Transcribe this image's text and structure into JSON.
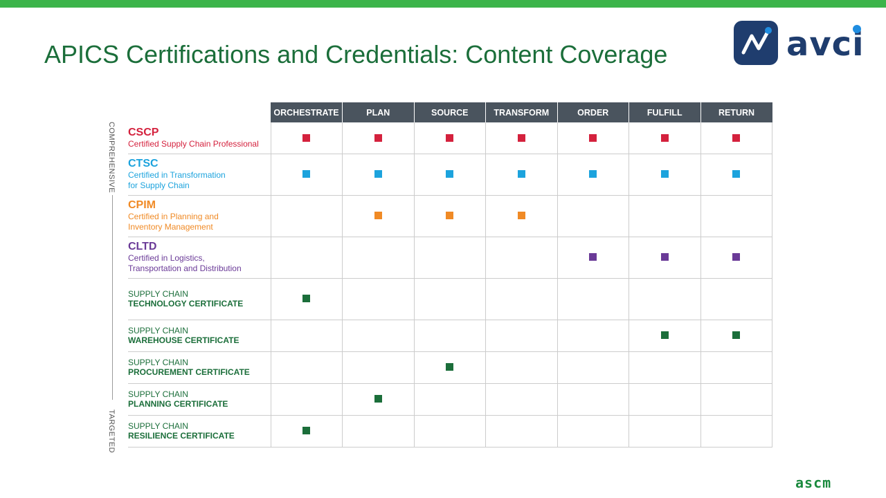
{
  "slide": {
    "title": "APICS Certifications and Credentials: Content Coverage",
    "top_bar_color": "#3cb44a"
  },
  "logo": {
    "text": "avci",
    "icon": "chart-line-icon"
  },
  "footer_logo": {
    "text": "ascm"
  },
  "side_labels": {
    "top": "COMPREHENSIVE",
    "bottom": "TARGETED"
  },
  "table": {
    "columns": [
      "ORCHESTRATE",
      "PLAN",
      "SOURCE",
      "TRANSFORM",
      "ORDER",
      "FULFILL",
      "RETURN"
    ],
    "rows": [
      {
        "code": "CSCP",
        "full": "Certified Supply Chain Professional",
        "full2": "",
        "color": "#d4213d",
        "marks": [
          1,
          1,
          1,
          1,
          1,
          1,
          1
        ]
      },
      {
        "code": "CTSC",
        "full": "Certified in Transformation",
        "full2": "for Supply Chain",
        "color": "#1ca3dd",
        "marks": [
          1,
          1,
          1,
          1,
          1,
          1,
          1
        ]
      },
      {
        "code": "CPIM",
        "full": "Certified in Planning and",
        "full2": "Inventory Management",
        "color": "#f08a25",
        "marks": [
          0,
          1,
          1,
          1,
          0,
          0,
          0
        ]
      },
      {
        "code": "CLTD",
        "full": "Certified in Logistics,",
        "full2": "Transportation and Distribution",
        "color": "#6a3a97",
        "marks": [
          0,
          0,
          0,
          0,
          1,
          1,
          1
        ]
      },
      {
        "top": "SUPPLY CHAIN",
        "bottom": "TECHNOLOGY CERTIFICATE",
        "color": "#1b6e3a",
        "marks": [
          1,
          0,
          0,
          0,
          0,
          0,
          0
        ]
      },
      {
        "top": "SUPPLY CHAIN",
        "bottom": "WAREHOUSE CERTIFICATE",
        "color": "#1b6e3a",
        "marks": [
          0,
          0,
          0,
          0,
          0,
          1,
          1
        ]
      },
      {
        "top": "SUPPLY CHAIN",
        "bottom": "PROCUREMENT CERTIFICATE",
        "color": "#1b6e3a",
        "marks": [
          0,
          0,
          1,
          0,
          0,
          0,
          0
        ]
      },
      {
        "top": "SUPPLY CHAIN",
        "bottom": "PLANNING CERTIFICATE",
        "color": "#1b6e3a",
        "marks": [
          0,
          1,
          0,
          0,
          0,
          0,
          0
        ]
      },
      {
        "top": "SUPPLY CHAIN",
        "bottom": "RESILIENCE CERTIFICATE",
        "color": "#1b6e3a",
        "marks": [
          1,
          0,
          0,
          0,
          0,
          0,
          0
        ]
      }
    ]
  }
}
